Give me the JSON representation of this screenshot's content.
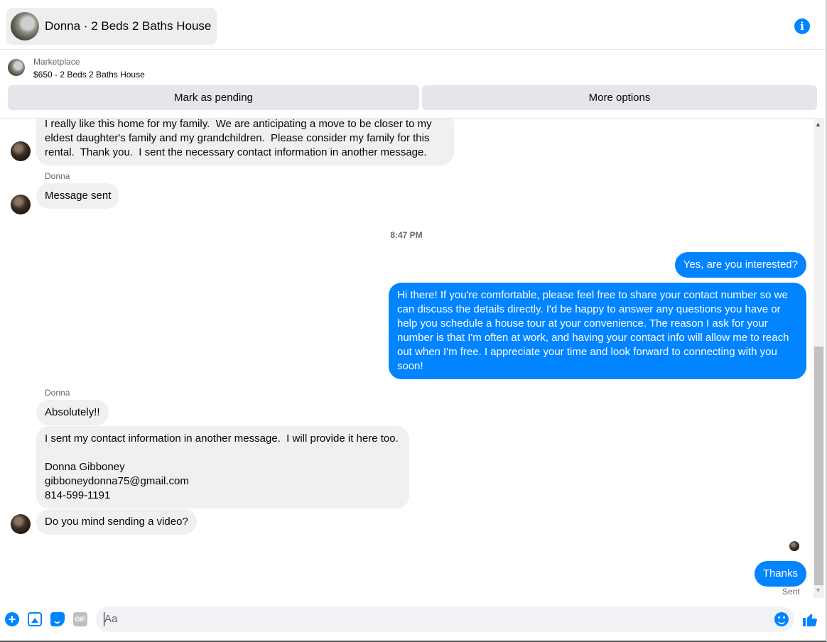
{
  "header": {
    "title": "Donna · 2 Beds 2 Baths House",
    "info_icon": "info-icon"
  },
  "marketplace": {
    "label": "Marketplace",
    "listing": "$650 - 2 Beds 2 Baths House",
    "mark_pending": "Mark as pending",
    "more_options": "More options"
  },
  "messages": {
    "m1": "I really like this home for my family.  We are anticipating a move to be closer to my\neldest daughter's family and my grandchildren.  Please consider my family for this\nrental.  Thank you.  I sent the necessary contact information in another message.",
    "sender1": "Donna",
    "m2": "Message sent",
    "time": "8:47 PM",
    "m3": "Yes, are you interested?",
    "m4": "Hi there! If you're comfortable, please feel free to share your contact number so we\ncan discuss the details directly. I'd be happy to answer any questions you have or\nhelp you schedule a house tour at your convenience. The reason I ask for your\nnumber is that I'm often at work, and having your contact info will allow me to reach\nout when I'm free. I appreciate your time and look forward to connecting with you\nsoon!",
    "sender2": "Donna",
    "m5": "Absolutely!!",
    "m6": "I sent my contact information in another message.  I will provide it here too.\n\nDonna Gibboney\ngibboneydonna75@gmail.com\n814-599-1191",
    "m7": "Do you mind sending a video?",
    "m8": "Thanks",
    "status": "Sent"
  },
  "composer": {
    "placeholder": "Aa",
    "gif_label": "GIF",
    "plus_glyph": "+"
  },
  "colors": {
    "accent": "#0084ff",
    "incoming_bubble": "#f0f0f0"
  }
}
